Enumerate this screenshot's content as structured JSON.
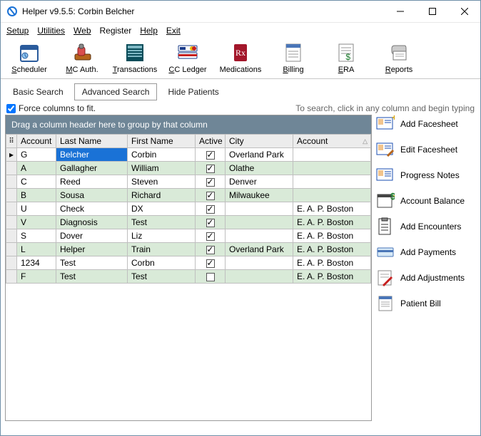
{
  "window": {
    "title": "Helper v9.5.5: Corbin Belcher"
  },
  "menu": {
    "setup": "Setup",
    "utilities": "Utilities",
    "web": "Web",
    "register": "Register",
    "help": "Help",
    "exit": "Exit"
  },
  "toolbar": [
    {
      "id": "scheduler",
      "label": "Scheduler",
      "mn": "S"
    },
    {
      "id": "mc-auth",
      "label": "MC Auth.",
      "mn": "M"
    },
    {
      "id": "transactions",
      "label": "Transactions",
      "mn": "T"
    },
    {
      "id": "cc-ledger",
      "label": "CC Ledger",
      "mn": "C"
    },
    {
      "id": "medications",
      "label": "Medications",
      "mn": ""
    },
    {
      "id": "billing",
      "label": "Billing",
      "mn": "B"
    },
    {
      "id": "era",
      "label": "ERA",
      "mn": "E"
    },
    {
      "id": "reports",
      "label": "Reports",
      "mn": "R"
    }
  ],
  "tabs": {
    "basic": "Basic Search",
    "advanced": "Advanced Search",
    "hide": "Hide Patients",
    "active": "advanced"
  },
  "opts": {
    "force_fit": "Force columns to fit.",
    "force_fit_checked": true,
    "hint": "To search, click in any column and begin typing"
  },
  "grid": {
    "group_hint": "Drag a column header here to group by that column",
    "columns": [
      "Account",
      "Last Name",
      "First Name",
      "Active",
      "City",
      "Account"
    ],
    "rows": [
      {
        "ind": "▸",
        "c": [
          "G",
          "Belcher",
          "Corbin",
          true,
          "Overland Park",
          ""
        ],
        "sel_col": 1
      },
      {
        "ind": "",
        "c": [
          "A",
          "Gallagher",
          "William",
          true,
          "Olathe",
          ""
        ]
      },
      {
        "ind": "",
        "c": [
          "C",
          "Reed",
          "Steven",
          true,
          "Denver",
          ""
        ]
      },
      {
        "ind": "",
        "c": [
          "B",
          "Sousa",
          "Richard",
          true,
          "Milwaukee",
          ""
        ]
      },
      {
        "ind": "",
        "c": [
          "U",
          "Check",
          "DX",
          true,
          "",
          "E. A. P. Boston"
        ]
      },
      {
        "ind": "",
        "c": [
          "V",
          "Diagnosis",
          "Test",
          true,
          "",
          "E. A. P. Boston"
        ]
      },
      {
        "ind": "",
        "c": [
          "S",
          "Dover",
          "Liz",
          true,
          "",
          "E. A. P. Boston"
        ]
      },
      {
        "ind": "",
        "c": [
          "L",
          "Helper",
          "Train",
          true,
          "Overland Park",
          "E. A. P. Boston"
        ]
      },
      {
        "ind": "",
        "c": [
          "1234",
          "Test",
          "Corbn",
          true,
          "",
          "E. A. P. Boston"
        ]
      },
      {
        "ind": "",
        "c": [
          "F",
          "Test",
          "Test",
          false,
          "",
          "E. A. P. Boston"
        ]
      }
    ]
  },
  "actions": [
    {
      "id": "add-facesheet",
      "label": "Add Facesheet"
    },
    {
      "id": "edit-facesheet",
      "label": "Edit Facesheet"
    },
    {
      "id": "progress-notes",
      "label": "Progress Notes"
    },
    {
      "id": "account-balance",
      "label": "Account Balance"
    },
    {
      "id": "add-encounters",
      "label": "Add Encounters"
    },
    {
      "id": "add-payments",
      "label": "Add Payments"
    },
    {
      "id": "add-adjustments",
      "label": "Add Adjustments"
    },
    {
      "id": "patient-bill",
      "label": "Patient Bill"
    }
  ]
}
